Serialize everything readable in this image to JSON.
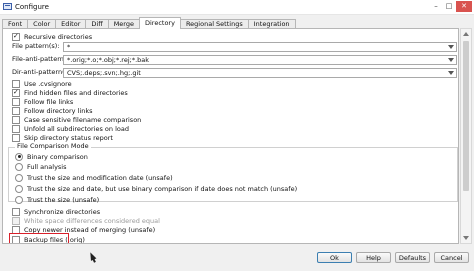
{
  "window": {
    "title": "Configure"
  },
  "tabs": [
    "Font",
    "Color",
    "Editor",
    "Diff",
    "Merge",
    "Directory",
    "Regional Settings",
    "Integration"
  ],
  "active_tab": "Directory",
  "fields": {
    "recursive": {
      "label": "Recursive directories",
      "checked": true
    },
    "file_pattern": {
      "label": "File pattern(s):",
      "value": "*"
    },
    "file_anti_pattern": {
      "label": "File-anti-pattern(s):",
      "value": "*.orig;*.o;*.obj;*.rej;*.bak"
    },
    "dir_anti_pattern": {
      "label": "Dir-anti-pattern(s):",
      "value": "CVS;.deps;.svn;.hg;.git"
    }
  },
  "options": [
    {
      "label": "Use .cvsignore",
      "checked": false
    },
    {
      "label": "Find hidden files and directories",
      "checked": true
    },
    {
      "label": "Follow file links",
      "checked": false
    },
    {
      "label": "Follow directory links",
      "checked": false
    },
    {
      "label": "Case sensitive filename comparison",
      "checked": false
    },
    {
      "label": "Unfold all subdirectories on load",
      "checked": false
    },
    {
      "label": "Skip directory status report",
      "checked": false
    }
  ],
  "comparison": {
    "title": "File Comparison Mode",
    "modes": [
      {
        "label": "Binary comparison",
        "selected": true
      },
      {
        "label": "Full analysis",
        "selected": false
      },
      {
        "label": "Trust the size and modification date (unsafe)",
        "selected": false
      },
      {
        "label": "Trust the size and date, but use binary comparison if date does not match (unsafe)",
        "selected": false
      },
      {
        "label": "Trust the size (unsafe)",
        "selected": false
      }
    ]
  },
  "options_after": [
    {
      "label": "Synchronize directories",
      "checked": false,
      "disabled": false
    },
    {
      "label": "White space differences considered equal",
      "checked": false,
      "disabled": true
    },
    {
      "label": "Copy newer instead of merging (unsafe)",
      "checked": false,
      "disabled": false
    },
    {
      "label": "Backup files (.orig)",
      "checked": false,
      "disabled": false
    }
  ],
  "buttons": {
    "ok": "Ok",
    "help": "Help",
    "defaults": "Defaults",
    "cancel": "Cancel"
  }
}
